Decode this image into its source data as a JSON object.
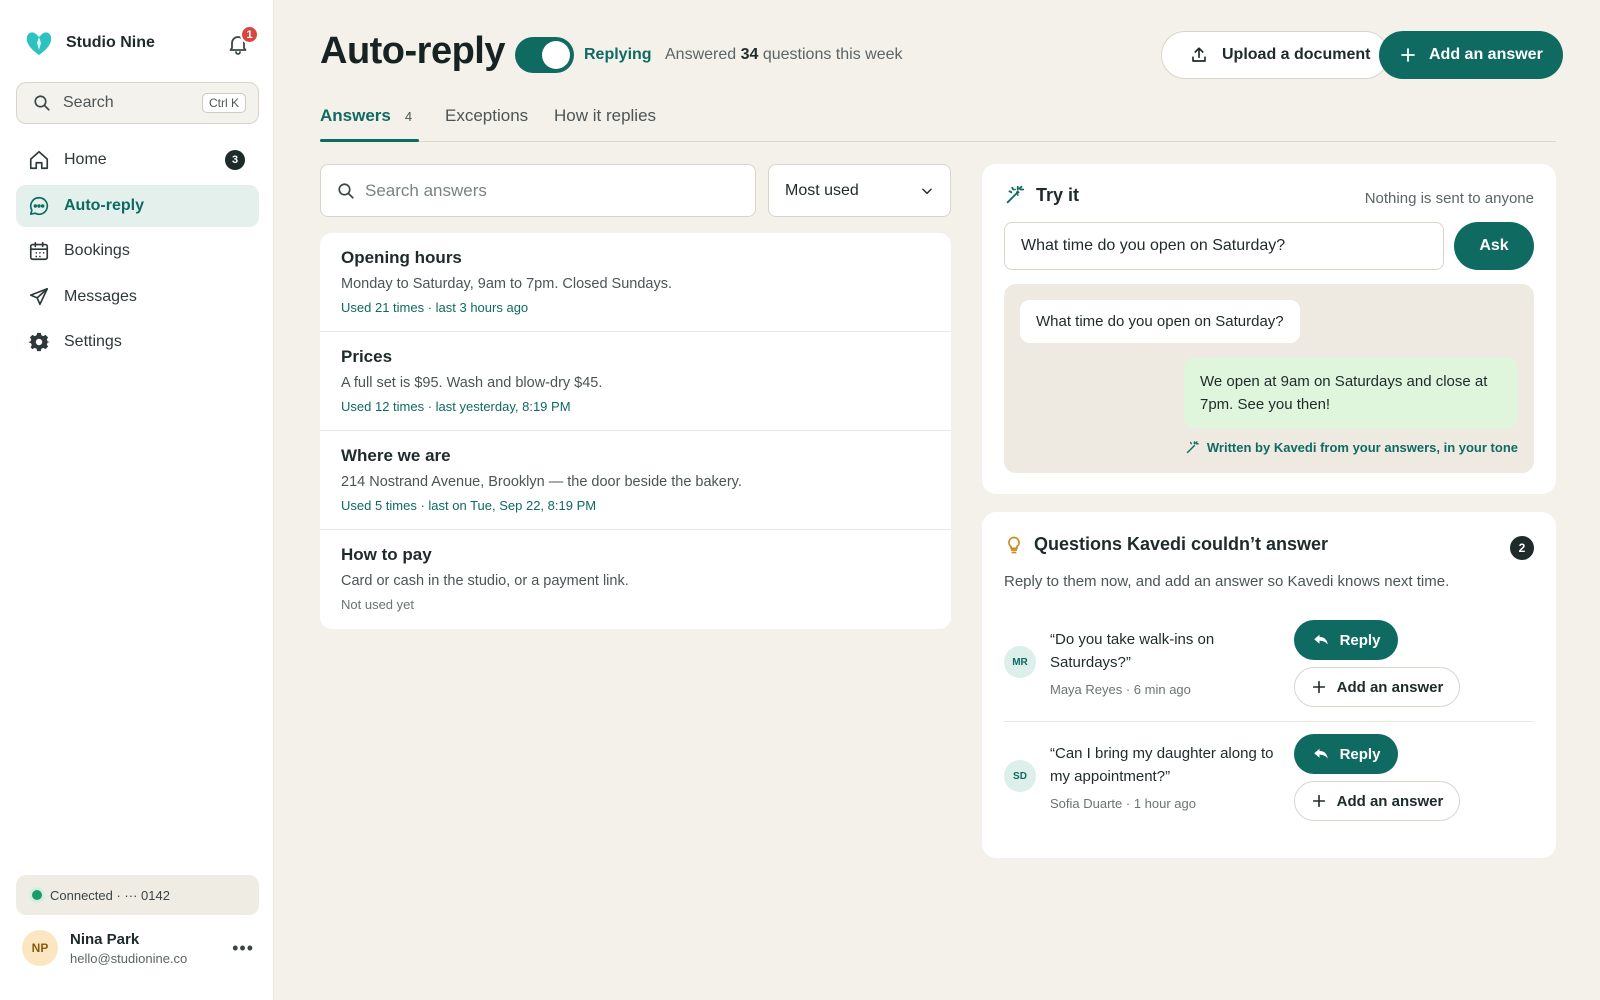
{
  "sidebar": {
    "brand": "Studio Nine",
    "notifications_count": "1",
    "search": {
      "placeholder": "Search",
      "shortcut": "Ctrl K"
    },
    "nav": [
      {
        "label": "Home",
        "icon": "home-icon",
        "badge": "3"
      },
      {
        "label": "Auto-reply",
        "icon": "chat-bubble-icon",
        "active": true
      },
      {
        "label": "Bookings",
        "icon": "calendar-icon"
      },
      {
        "label": "Messages",
        "icon": "paper-plane-icon"
      },
      {
        "label": "Settings",
        "icon": "gear-icon"
      }
    ],
    "connection": "Connected · ··· 0142",
    "user": {
      "initials": "NP",
      "name": "Nina Park",
      "email": "hello@studionine.co"
    }
  },
  "header": {
    "title": "Auto-reply",
    "toggle_on": true,
    "toggle_label": "Replying",
    "answered_prefix": "Answered",
    "answered_count": "34",
    "answered_suffix": "questions this week",
    "upload_label": "Upload a document",
    "add_label": "Add an answer"
  },
  "tabs": [
    {
      "label": "Answers",
      "count": "4",
      "active": true
    },
    {
      "label": "Exceptions"
    },
    {
      "label": "How it replies"
    }
  ],
  "answers_panel": {
    "search_placeholder": "Search answers",
    "sort_value": "Most used",
    "items": [
      {
        "title": "Opening hours",
        "body": "Monday to Saturday, 9am to 7pm. Closed Sundays.",
        "meta": "Used 21 times · last 3 hours ago"
      },
      {
        "title": "Prices",
        "body": "A full set is $95. Wash and blow-dry $45.",
        "meta": "Used 12 times · last yesterday, 8:19 PM"
      },
      {
        "title": "Where we are",
        "body": "214 Nostrand Avenue, Brooklyn — the door beside the bakery.",
        "meta": "Used 5 times · last on Tue, Sep 22, 8:19 PM"
      },
      {
        "title": "How to pay",
        "body": "Card or cash in the studio, or a payment link.",
        "meta": "Not used yet"
      }
    ]
  },
  "try_it": {
    "title": "Try it",
    "note": "Nothing is sent to anyone",
    "input_value": "What time do you open on Saturday?",
    "ask_label": "Ask",
    "question": "What time do you open on Saturday?",
    "answer": "We open at 9am on Saturdays and close at 7pm. See you then!",
    "written_by": "Written by Kavedi from your answers, in your tone"
  },
  "questions": {
    "title": "Questions Kavedi couldn’t answer",
    "count": "2",
    "subtitle": "Reply to them now, and add an answer so Kavedi knows next time.",
    "reply_label": "Reply",
    "add_label": "Add an answer",
    "items": [
      {
        "initials": "MR",
        "text": "“Do you take walk-ins on Saturdays?”",
        "meta": "Maya Reyes · 6 min ago"
      },
      {
        "initials": "SD",
        "text": "“Can I bring my daughter along to my appointment?”",
        "meta": "Sofia Duarte · 1 hour ago"
      }
    ]
  },
  "colors": {
    "accent": "#0f6a62",
    "background": "#f3f1ea",
    "badge_red": "#d9463f",
    "answer_bubble": "#dff5dc"
  }
}
